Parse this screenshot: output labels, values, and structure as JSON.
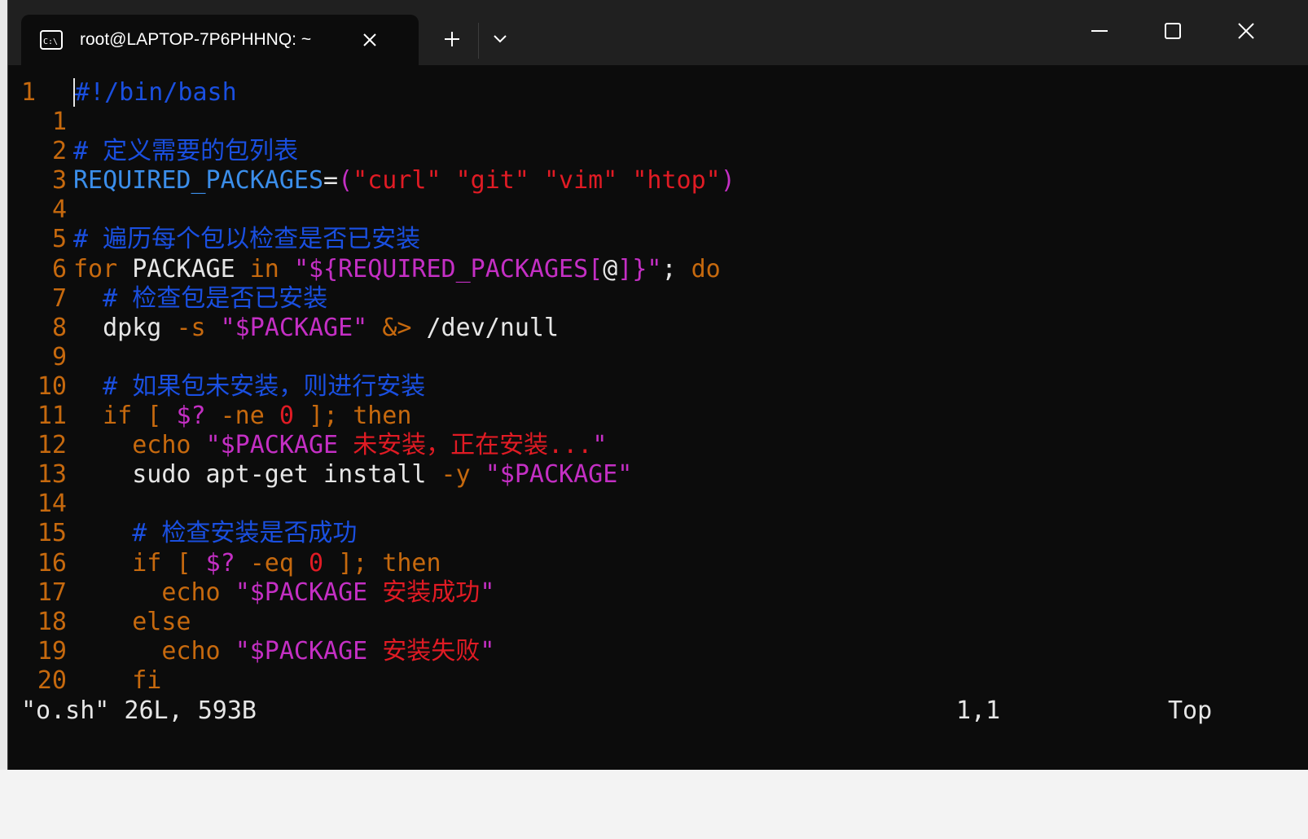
{
  "window": {
    "tab_title": "root@LAPTOP-7P6PHHNQ: ~",
    "tab_icon": "terminal-icon"
  },
  "editor": {
    "current_line_number": "1",
    "lines": [
      {
        "num": "1",
        "text": "#!/bin/bash"
      },
      {
        "num": "1",
        "text": ""
      },
      {
        "num": "2",
        "text": "# 定义需要的包列表"
      },
      {
        "num": "3",
        "text": "REQUIRED_PACKAGES=(\"curl\" \"git\" \"vim\" \"htop\")"
      },
      {
        "num": "4",
        "text": ""
      },
      {
        "num": "5",
        "text": "# 遍历每个包以检查是否已安装"
      },
      {
        "num": "6",
        "text": "for PACKAGE in \"${REQUIRED_PACKAGES[@]}\"; do"
      },
      {
        "num": "7",
        "text": "  # 检查包是否已安装"
      },
      {
        "num": "8",
        "text": "  dpkg -s \"$PACKAGE\" &> /dev/null"
      },
      {
        "num": "9",
        "text": ""
      },
      {
        "num": "10",
        "text": "  # 如果包未安装，则进行安装"
      },
      {
        "num": "11",
        "text": "  if [ $? -ne 0 ]; then"
      },
      {
        "num": "12",
        "text": "    echo \"$PACKAGE 未安装，正在安装...\""
      },
      {
        "num": "13",
        "text": "    sudo apt-get install -y \"$PACKAGE\""
      },
      {
        "num": "14",
        "text": ""
      },
      {
        "num": "15",
        "text": "    # 检查安装是否成功"
      },
      {
        "num": "16",
        "text": "    if [ $? -eq 0 ]; then"
      },
      {
        "num": "17",
        "text": "      echo \"$PACKAGE 安装成功\""
      },
      {
        "num": "18",
        "text": "    else"
      },
      {
        "num": "19",
        "text": "      echo \"$PACKAGE 安装失败\""
      },
      {
        "num": "20",
        "text": "    fi"
      }
    ]
  },
  "status": {
    "file_info": "\"o.sh\" 26L, 593B",
    "cursor_pos": "1,1",
    "scroll": "Top"
  },
  "colors": {
    "background": "#0c0c0c",
    "line_number": "#c6690e",
    "comment": "#1a4fe0",
    "string": "#c42fc4",
    "keyword": "#c6690e",
    "variable_name": "#3b8eea",
    "cjk_string": "#e01b24"
  }
}
